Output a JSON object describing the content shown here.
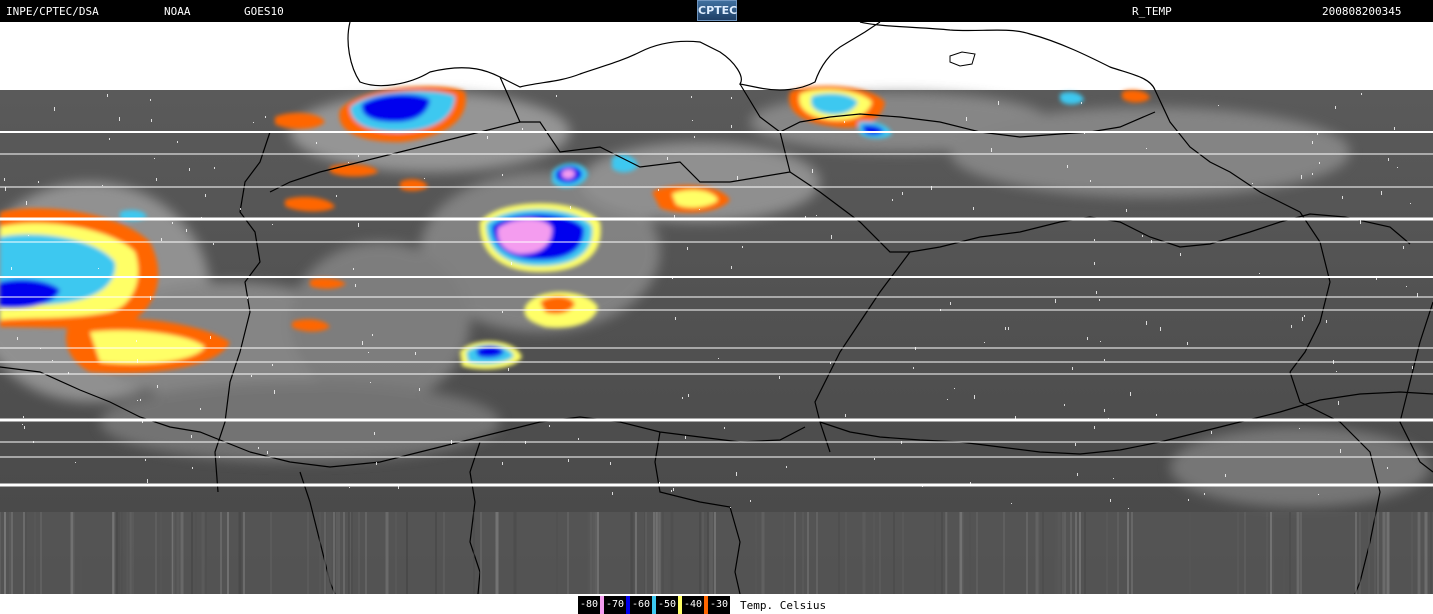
{
  "header": {
    "source": "INPE/CPTEC/DSA",
    "agency": "NOAA",
    "satellite": "GOES10",
    "logo": "CPTEC",
    "product": "R_TEMP",
    "datetime": "200808200345"
  },
  "legend": {
    "items": [
      {
        "label": "-80",
        "color": "#f49cef"
      },
      {
        "label": "-70",
        "color": "#0000ee"
      },
      {
        "label": "-60",
        "color": "#3cc8f0"
      },
      {
        "label": "-50",
        "color": "#ffff66"
      },
      {
        "label": "-40",
        "color": "#ff6600"
      },
      {
        "label": "-30",
        "color": "#ffffff"
      }
    ],
    "unit": "Temp. Celsius"
  },
  "colors": {
    "ground": "#4a4a4a",
    "cloud": "#bdbdbd",
    "border": "#000000",
    "scan_line": "#ffffff"
  }
}
